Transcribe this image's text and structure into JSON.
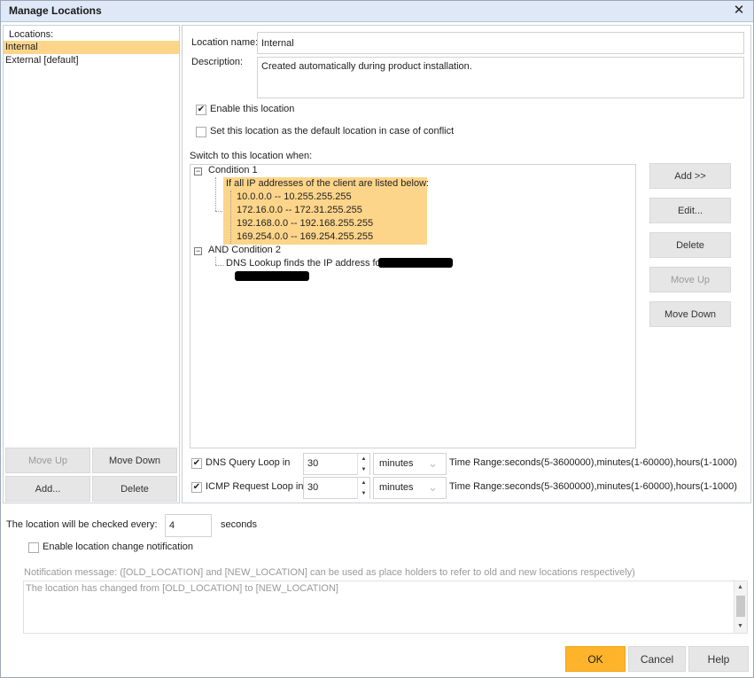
{
  "window": {
    "title": "Manage Locations",
    "close_icon": "close-icon"
  },
  "locations": {
    "label": "Locations:",
    "items": [
      {
        "label": "Internal",
        "selected": true
      },
      {
        "label": "External [default]",
        "selected": false
      }
    ],
    "buttons": {
      "move_up": "Move Up",
      "move_down": "Move Down",
      "add": "Add...",
      "delete": "Delete"
    }
  },
  "detail": {
    "name_label": "Location name:",
    "name_value": "Internal",
    "description_label": "Description:",
    "description_value": "Created automatically during product installation.",
    "enable_label": "Enable this location",
    "enable_checked": true,
    "default_label": "Set this location as the default location in case of conflict",
    "default_checked": false,
    "switch_label": "Switch to this location when:"
  },
  "conditions": {
    "condition1": {
      "title": "Condition 1",
      "rule": "If all IP addresses of the client are listed below:",
      "ranges": [
        "10.0.0.0 -- 10.255.255.255",
        "172.16.0.0 -- 172.31.255.255",
        "192.168.0.0 -- 192.168.255.255",
        "169.254.0.0 -- 169.254.255.255"
      ]
    },
    "condition2": {
      "title": "AND Condition 2",
      "rule": "DNS Lookup finds the IP address for"
    },
    "buttons": {
      "add": "Add >>",
      "edit": "Edit...",
      "delete": "Delete",
      "move_up": "Move Up",
      "move_down": "Move Down"
    }
  },
  "loops": {
    "dns": {
      "label": "DNS Query Loop in",
      "checked": true,
      "value": "30",
      "unit": "minutes",
      "range": "Time Range:seconds(5-3600000),minutes(1-60000),hours(1-1000)"
    },
    "icmp": {
      "label": "ICMP Request Loop in",
      "checked": true,
      "value": "30",
      "unit": "minutes",
      "range": "Time Range:seconds(5-3600000),minutes(1-60000),hours(1-1000)"
    }
  },
  "check": {
    "label": "The location will be checked every:",
    "value": "4",
    "unit": "seconds"
  },
  "notification": {
    "enable_label": "Enable location change notification",
    "enable_checked": false,
    "message_label": "Notification message: ([OLD_LOCATION] and [NEW_LOCATION] can be used as place holders to refer to old and new locations respectively)",
    "message_value": "The location has changed from [OLD_LOCATION] to [NEW_LOCATION]"
  },
  "footer": {
    "ok": "OK",
    "cancel": "Cancel",
    "help": "Help"
  }
}
